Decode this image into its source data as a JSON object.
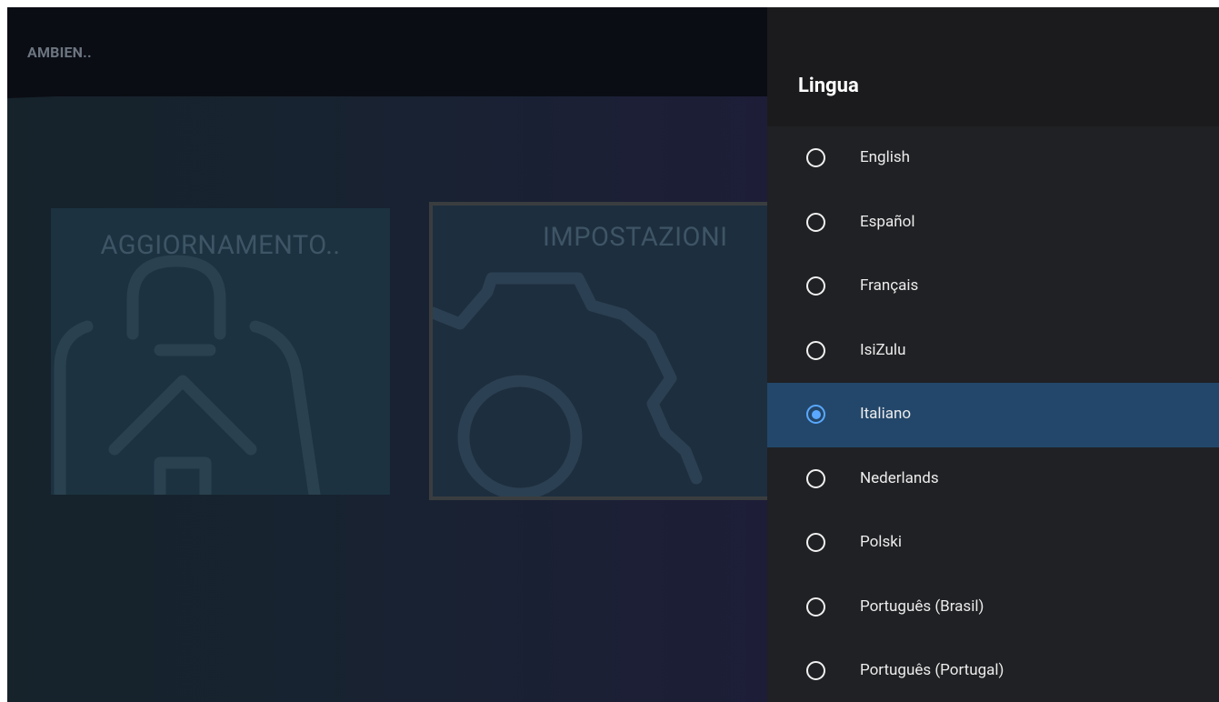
{
  "app": {
    "title": "AMBIEN.."
  },
  "tiles": [
    {
      "label": "AGGIORNAMENTO..",
      "icon": "bag-upload-icon"
    },
    {
      "label": "IMPOSTAZIONI",
      "icon": "gear-icon"
    }
  ],
  "language_panel": {
    "title": "Lingua",
    "selected": "Italiano",
    "options": [
      {
        "label": "English",
        "selected": false
      },
      {
        "label": "Español",
        "selected": false
      },
      {
        "label": "Français",
        "selected": false
      },
      {
        "label": "IsiZulu",
        "selected": false
      },
      {
        "label": "Italiano",
        "selected": true
      },
      {
        "label": "Nederlands",
        "selected": false
      },
      {
        "label": "Polski",
        "selected": false
      },
      {
        "label": "Português (Brasil)",
        "selected": false
      },
      {
        "label": "Português (Portugal)",
        "selected": false
      }
    ]
  },
  "colors": {
    "accent": "#5aa8ff",
    "selected_row": "#23476a",
    "panel_bg": "#202124"
  }
}
